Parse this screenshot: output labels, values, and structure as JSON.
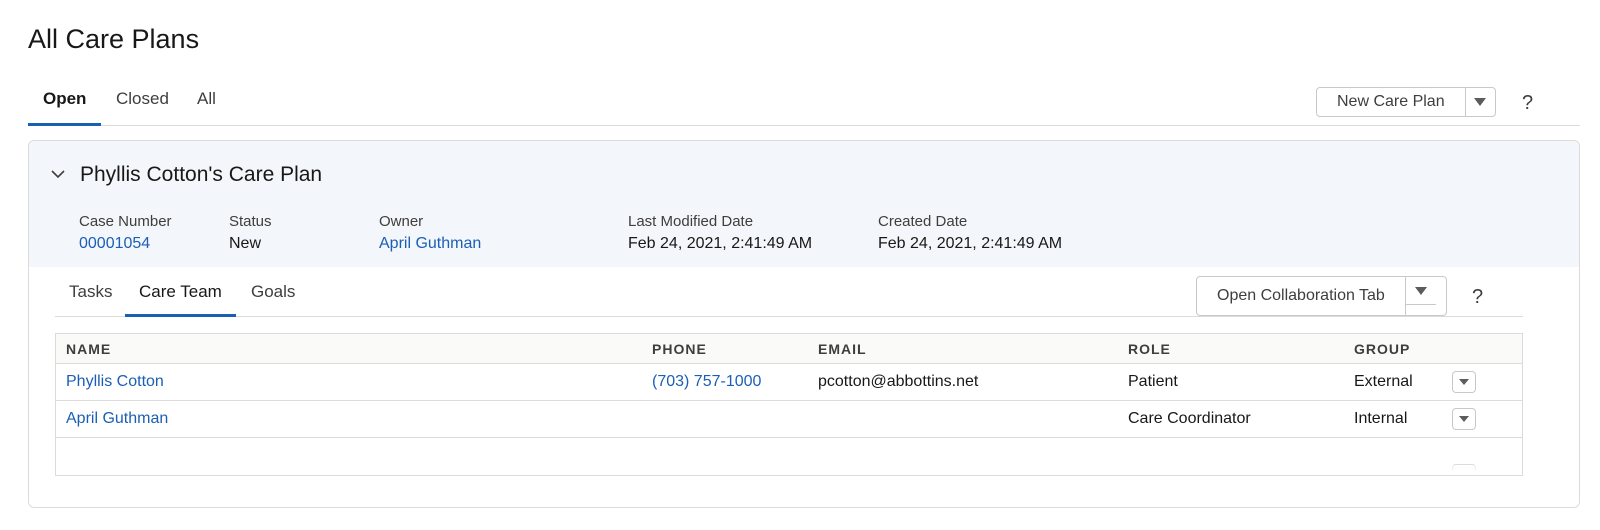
{
  "page": {
    "title": "All Care Plans"
  },
  "top_tabs": [
    {
      "label": "Open",
      "active": true
    },
    {
      "label": "Closed",
      "active": false
    },
    {
      "label": "All",
      "active": false
    }
  ],
  "new_button": {
    "label": "New Care Plan",
    "icon": "chevron-down-icon"
  },
  "help_label": "?",
  "care_plan": {
    "title": "Phyllis Cotton's Care Plan",
    "fields": {
      "case_number": {
        "label": "Case Number",
        "value": "00001054"
      },
      "status": {
        "label": "Status",
        "value": "New"
      },
      "owner": {
        "label": "Owner",
        "value": "April Guthman"
      },
      "last_modified": {
        "label": "Last Modified Date",
        "value": "Feb 24, 2021, 2:41:49 AM"
      },
      "created": {
        "label": "Created Date",
        "value": "Feb 24, 2021, 2:41:49 AM"
      }
    },
    "sub_tabs": [
      {
        "label": "Tasks",
        "active": false
      },
      {
        "label": "Care Team",
        "active": true
      },
      {
        "label": "Goals",
        "active": false
      }
    ],
    "collab_button": {
      "label": "Open Collaboration Tab",
      "icon": "chevron-down-icon"
    },
    "table": {
      "headers": [
        "NAME",
        "PHONE",
        "EMAIL",
        "ROLE",
        "GROUP"
      ],
      "rows": [
        {
          "name": "Phyllis Cotton",
          "phone": "(703) 757-1000",
          "email": "pcotton@abbottins.net",
          "role": "Patient",
          "group": "External"
        },
        {
          "name": "April Guthman",
          "phone": "",
          "email": "",
          "role": "Care Coordinator",
          "group": "Internal"
        }
      ]
    }
  },
  "colors": {
    "link": "#1b5fb5",
    "accent": "#1b5fb5",
    "header_bg": "#f3f6fa"
  }
}
